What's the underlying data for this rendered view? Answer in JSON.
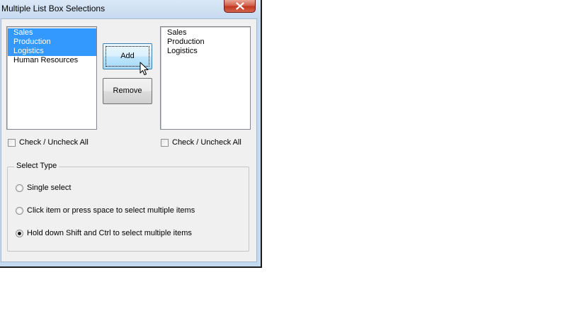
{
  "window": {
    "title": "Multiple List Box Selections",
    "close_glyph": "✕"
  },
  "left_list": {
    "items": [
      {
        "label": "Sales",
        "selected": true
      },
      {
        "label": "Production",
        "selected": true
      },
      {
        "label": "Logistics",
        "selected": true
      },
      {
        "label": "Human Resources",
        "selected": false
      }
    ]
  },
  "right_list": {
    "items": [
      {
        "label": "Sales"
      },
      {
        "label": "Production"
      },
      {
        "label": "Logistics"
      }
    ]
  },
  "buttons": {
    "add_label": "Add",
    "remove_label": "Remove"
  },
  "left_check_all": {
    "label": "Check / Uncheck All",
    "checked": false
  },
  "right_check_all": {
    "label": "Check / Uncheck All",
    "checked": false
  },
  "select_type": {
    "legend": "Select Type",
    "options": [
      {
        "label": "Single select",
        "checked": false
      },
      {
        "label": "Click item or press space to select multiple items",
        "checked": false
      },
      {
        "label": "Hold down Shift and Ctrl to select multiple items",
        "checked": true
      }
    ]
  },
  "icons": {
    "close": "close-icon",
    "cursor": "mouse-pointer-icon"
  },
  "colors": {
    "selection": "#3399ff",
    "client_bg": "#f0f0f0",
    "close_button": "#c0351d"
  }
}
